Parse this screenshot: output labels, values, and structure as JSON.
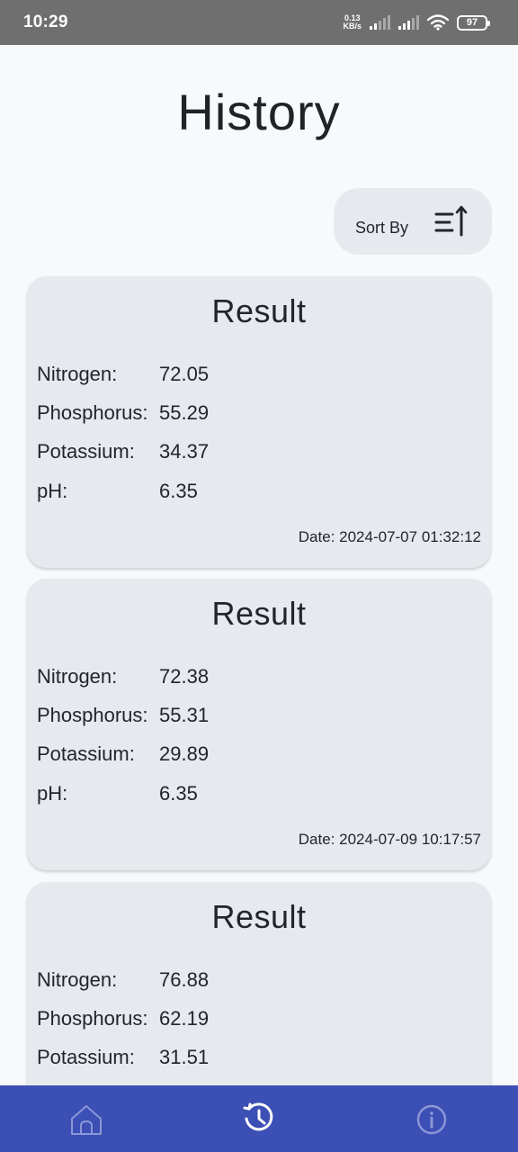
{
  "status_bar": {
    "time": "10:29",
    "net_speed_value": "0.13",
    "net_speed_unit": "KB/s",
    "battery": "97"
  },
  "page": {
    "title": "History"
  },
  "sort": {
    "label": "Sort By",
    "icon": "sort-ascending-icon"
  },
  "labels": {
    "card_title": "Result",
    "nitrogen": "Nitrogen:",
    "phosphorus": "Phosphorus:",
    "potassium": "Potassium:",
    "ph": "pH:"
  },
  "results": [
    {
      "nitrogen": "72.05",
      "phosphorus": "55.29",
      "potassium": "34.37",
      "ph": "6.35",
      "date": "Date: 2024-07-07 01:32:12"
    },
    {
      "nitrogen": "72.38",
      "phosphorus": "55.31",
      "potassium": "29.89",
      "ph": "6.35",
      "date": "Date: 2024-07-09 10:17:57"
    },
    {
      "nitrogen": "76.88",
      "phosphorus": "62.19",
      "potassium": "31.51"
    }
  ],
  "bottom_nav": {
    "items": [
      {
        "icon": "home-icon",
        "active": false
      },
      {
        "icon": "history-icon",
        "active": true
      },
      {
        "icon": "info-icon",
        "active": false
      }
    ]
  },
  "colors": {
    "nav_background": "#3c4fb5",
    "card_background": "#e6e9ed",
    "page_background": "#f7f9fb",
    "status_bar": "#6f6f6f"
  }
}
